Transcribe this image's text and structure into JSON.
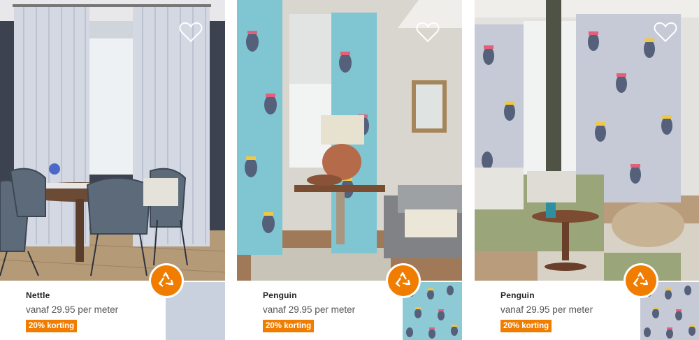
{
  "colors": {
    "accent": "#f07d00",
    "text": "#333333"
  },
  "products": [
    {
      "name": "Nettle",
      "price": "vanaf 29.95 per meter",
      "discount": "20% korting",
      "favorite_icon": "heart-outline-icon",
      "eco_icon": "recycle-icon",
      "swatch_color": "#c9d1de"
    },
    {
      "name": "Penguin",
      "price": "vanaf 29.95 per meter",
      "discount": "20% korting",
      "favorite_icon": "heart-outline-icon",
      "eco_icon": "recycle-icon",
      "swatch_color": "#8ec9d6"
    },
    {
      "name": "Penguin",
      "price": "vanaf 29.95 per meter",
      "discount": "20% korting",
      "favorite_icon": "heart-outline-icon",
      "eco_icon": "recycle-icon",
      "swatch_color": "#c6c9d6"
    }
  ]
}
